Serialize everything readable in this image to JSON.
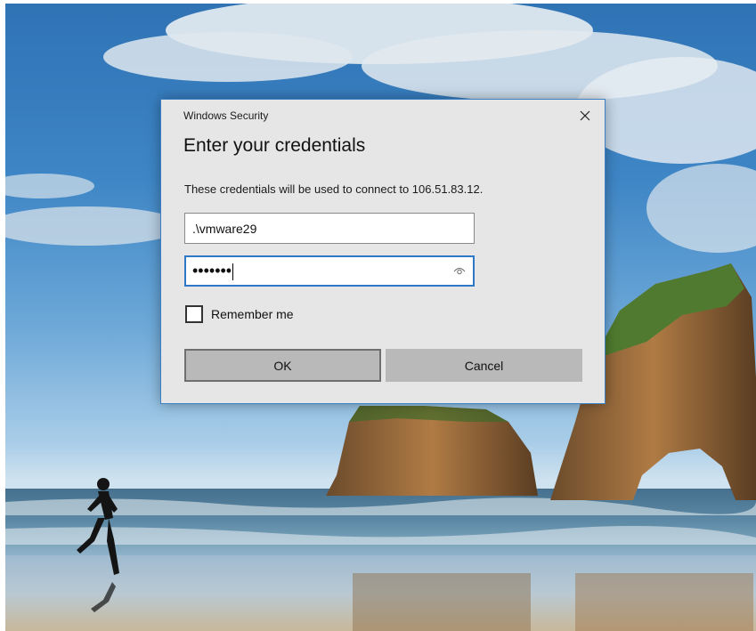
{
  "dialog": {
    "caption": "Windows Security",
    "heading": "Enter your credentials",
    "message": "These credentials will be used to connect to 106.51.83.12.",
    "username_value": ".\\vmware29",
    "password_masked": "•••••••",
    "remember_label": "Remember me",
    "remember_checked": false,
    "ok_label": "OK",
    "cancel_label": "Cancel",
    "close_glyph": "✕"
  },
  "icons": {
    "close": "close-icon",
    "reveal_password": "eye-icon"
  },
  "colors": {
    "dialog_bg": "#e6e6e6",
    "dialog_border": "#3c7fc4",
    "focus_border": "#2e78c7",
    "button_bg": "#b9b9b9"
  }
}
